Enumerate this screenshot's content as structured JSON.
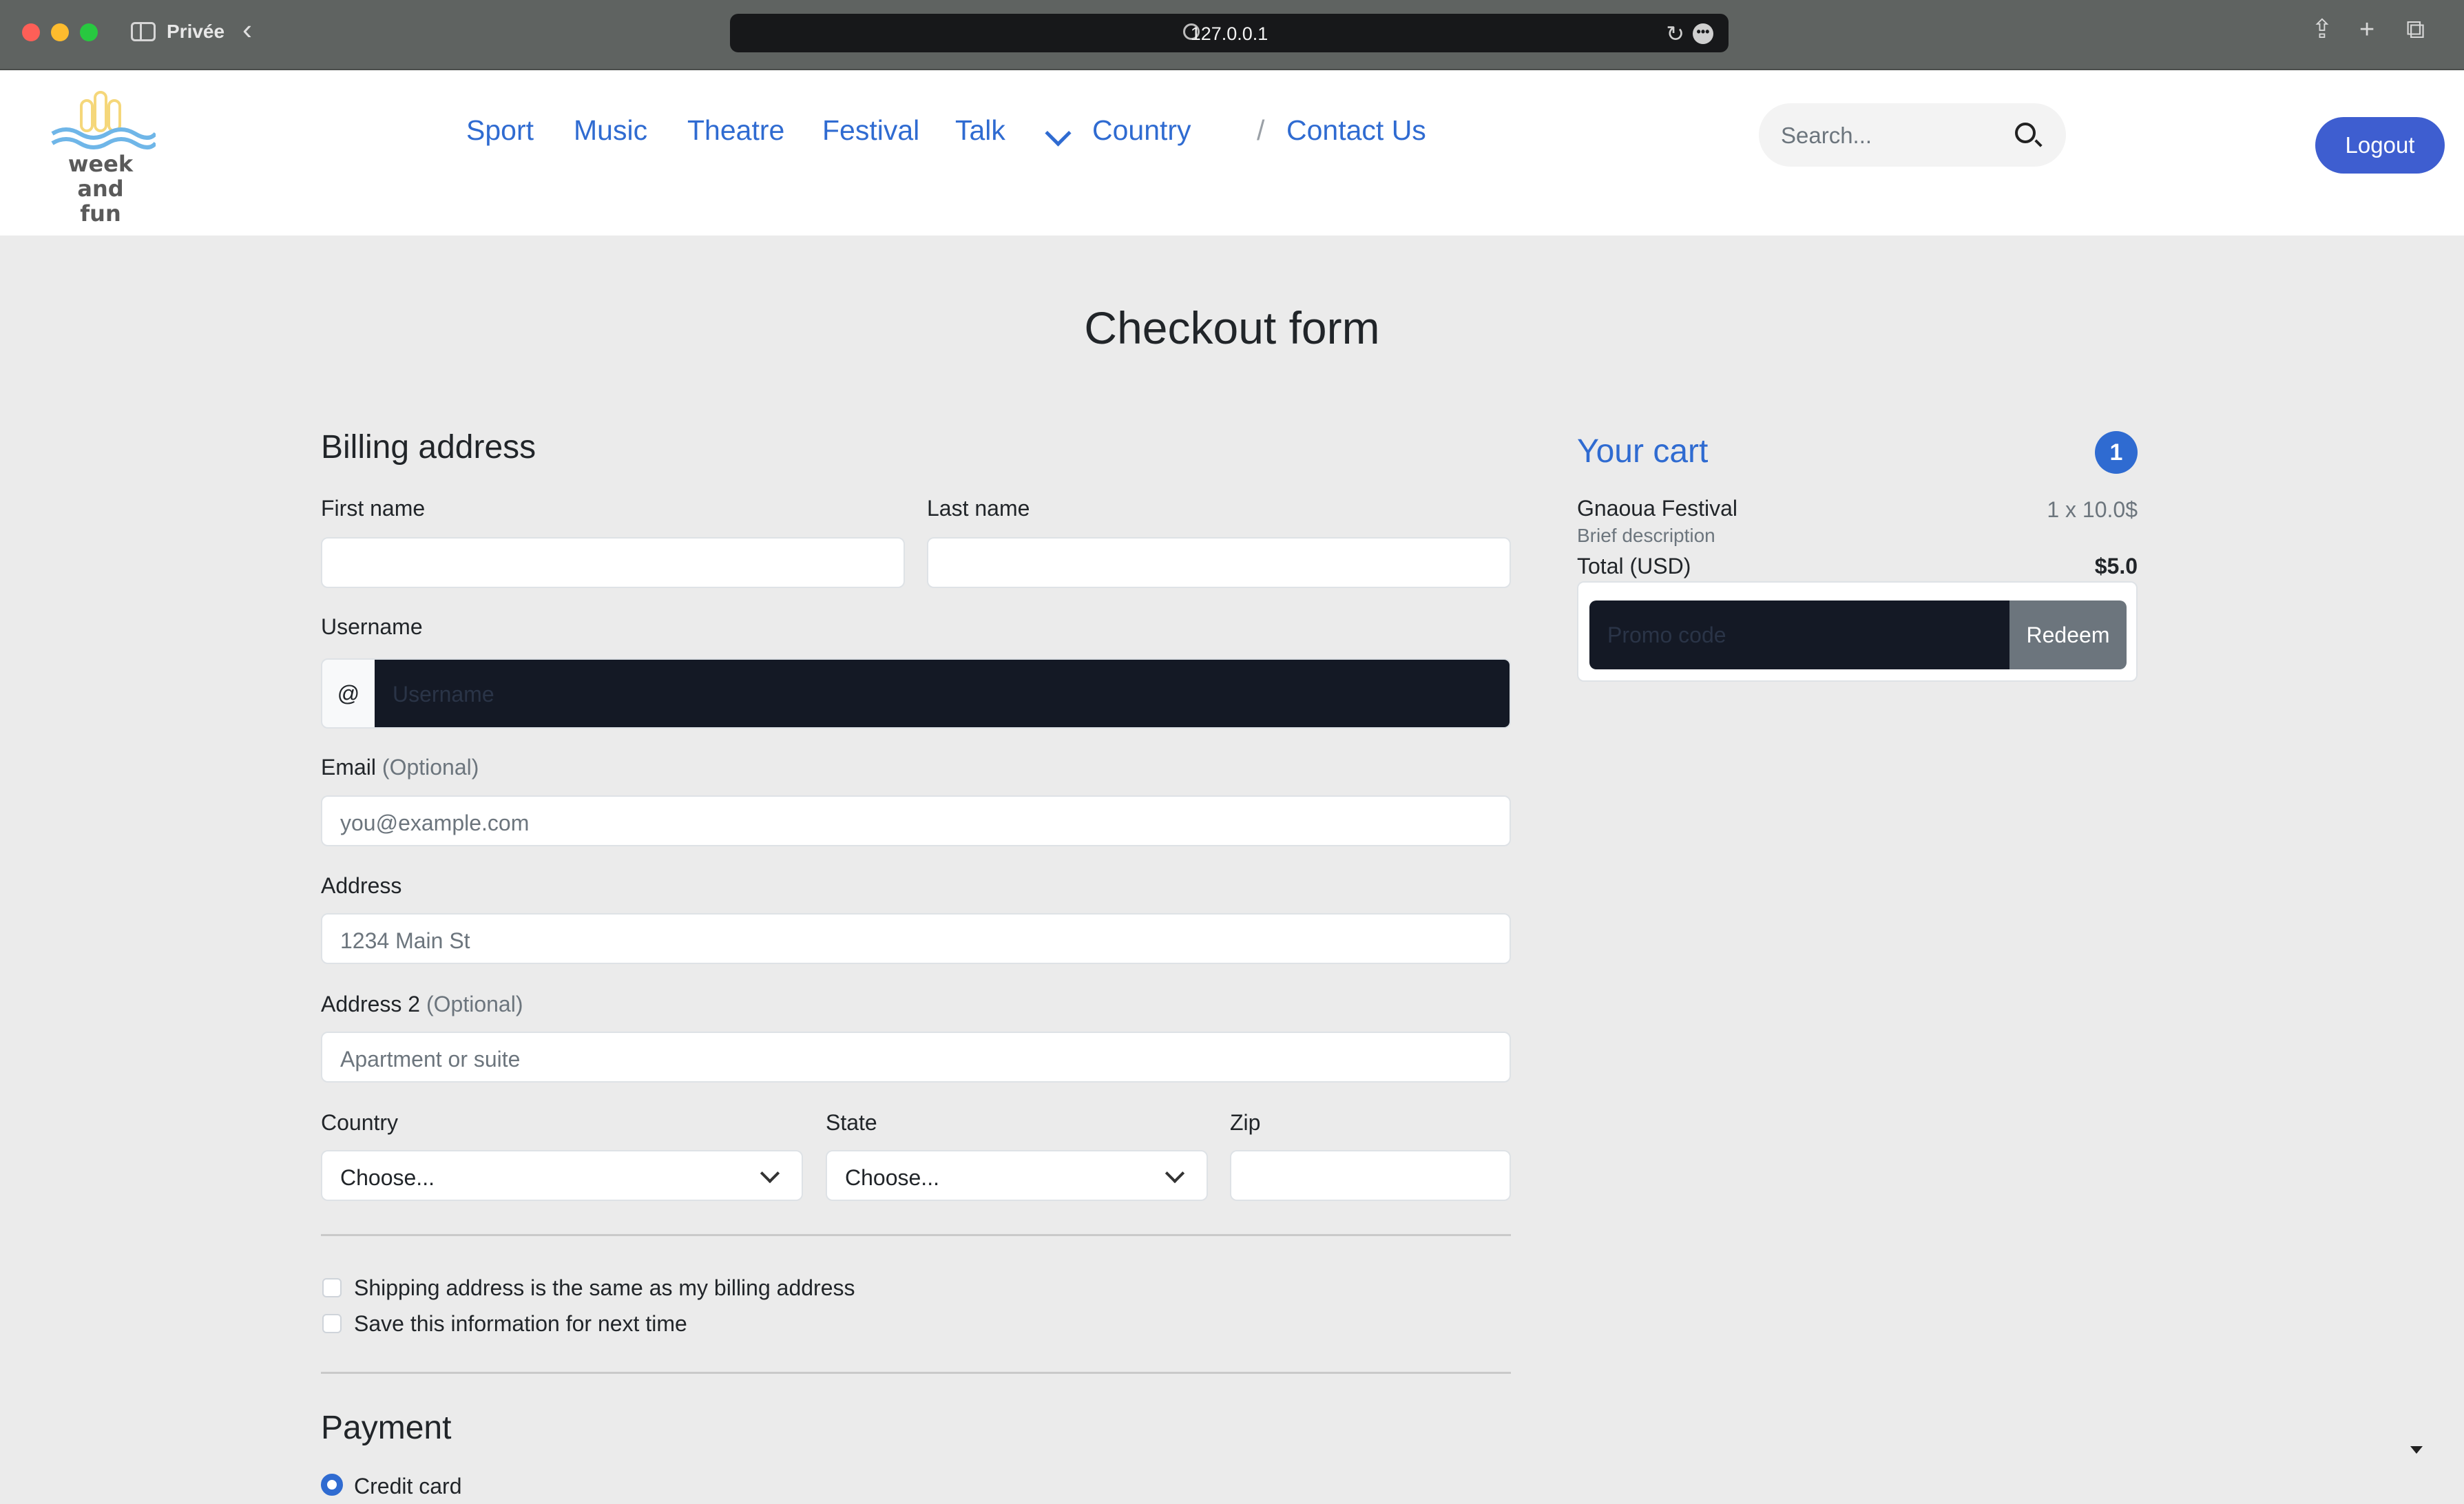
{
  "browser": {
    "private_label": "Privée",
    "url": "127.0.0.1"
  },
  "navbar": {
    "logo_text_line1": "week and",
    "logo_text_line2": "fun",
    "links": [
      "Sport",
      "Music",
      "Theatre",
      "Festival",
      "Talk"
    ],
    "country_dropdown": "Country",
    "separator": "/",
    "contact": "Contact Us",
    "search_placeholder": "Search...",
    "logout": "Logout"
  },
  "page": {
    "title": "Checkout form"
  },
  "billing": {
    "heading": "Billing address",
    "first_name_label": "First name",
    "last_name_label": "Last name",
    "username_label": "Username",
    "username_prefix": "@",
    "username_placeholder": "Username",
    "email_label": "Email",
    "email_optional": "(Optional)",
    "email_placeholder": "you@example.com",
    "address_label": "Address",
    "address_placeholder": "1234 Main St",
    "address2_label": "Address 2",
    "address2_optional": "(Optional)",
    "address2_placeholder": "Apartment or suite",
    "country_label": "Country",
    "country_value": "Choose...",
    "state_label": "State",
    "state_value": "Choose...",
    "zip_label": "Zip",
    "same_address_label": "Shipping address is the same as my billing address",
    "save_info_label": "Save this information for next time"
  },
  "payment": {
    "heading": "Payment",
    "credit_card_label": "Credit card"
  },
  "cart": {
    "title": "Your cart",
    "count": "1",
    "item_name": "Gnaoua Festival",
    "item_description": "Brief description",
    "item_price": "1 x 10.0$",
    "total_label": "Total (USD)",
    "total_value": "$5.0",
    "promo_placeholder": "Promo code",
    "redeem": "Redeem"
  },
  "colors": {
    "accent": "#2f6bd1",
    "logout_button": "#3e5ed0",
    "page_background": "#ebebeb",
    "dark_input": "#141925"
  }
}
